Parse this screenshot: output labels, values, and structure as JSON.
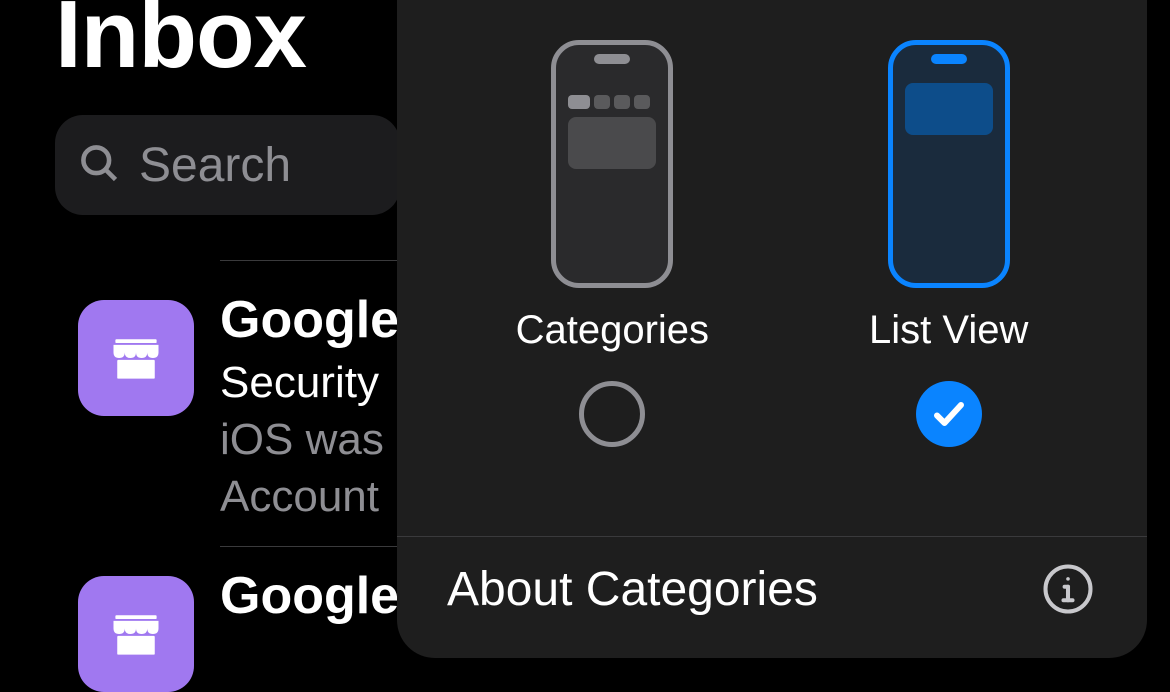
{
  "header": {
    "title": "Inbox"
  },
  "search": {
    "placeholder": "Search"
  },
  "emails": [
    {
      "sender": "Google",
      "subject": "Security",
      "preview_line1": "iOS was",
      "preview_line2": "Account"
    },
    {
      "sender": "Google",
      "subject": "",
      "preview_line1": "",
      "preview_line2": ""
    }
  ],
  "sheet": {
    "options": {
      "categories": {
        "label": "Categories",
        "selected": false
      },
      "list_view": {
        "label": "List View",
        "selected": true
      }
    },
    "about_label": "About Categories"
  }
}
